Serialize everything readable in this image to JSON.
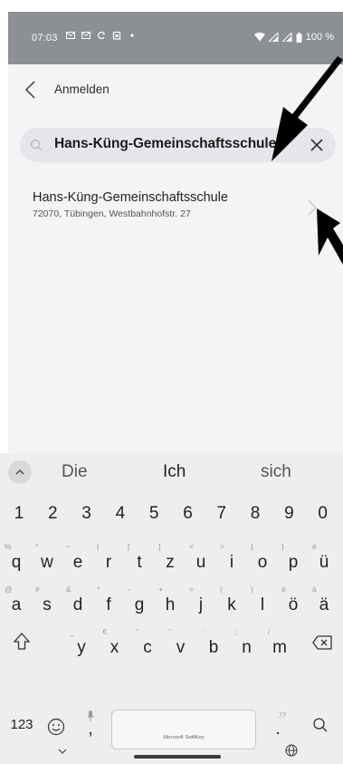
{
  "status_bar": {
    "time": "07:03",
    "left_icons": [
      "mail-icon",
      "mail-icon",
      "sync-icon",
      "calendar-icon",
      "dot-icon"
    ],
    "battery_text": "100 %"
  },
  "header": {
    "back_label": "Anmelden"
  },
  "search": {
    "value": "Hans-Küng-Gemeinschaftsschule"
  },
  "results": [
    {
      "title": "Hans-Küng-Gemeinschaftsschule",
      "subtitle": "72070, Tübingen, Westbahnhofstr. 27"
    }
  ],
  "keyboard": {
    "suggestions": [
      "Die",
      "Ich",
      "sich"
    ],
    "number_row": [
      "1",
      "2",
      "3",
      "4",
      "5",
      "6",
      "7",
      "8",
      "9",
      "0"
    ],
    "row1": [
      {
        "k": "q",
        "a": "%"
      },
      {
        "k": "w",
        "a": "^"
      },
      {
        "k": "e",
        "a": "~"
      },
      {
        "k": "r",
        "a": "|"
      },
      {
        "k": "t",
        "a": "["
      },
      {
        "k": "z",
        "a": "]"
      },
      {
        "k": "u",
        "a": "<"
      },
      {
        "k": "i",
        "a": ">"
      },
      {
        "k": "o",
        "a": "{"
      },
      {
        "k": "p",
        "a": "}"
      },
      {
        "k": "ü",
        "a": "è"
      }
    ],
    "row2": [
      {
        "k": "a",
        "a": "@"
      },
      {
        "k": "s",
        "a": "#"
      },
      {
        "k": "d",
        "a": "&"
      },
      {
        "k": "f",
        "a": "*"
      },
      {
        "k": "g",
        "a": "-"
      },
      {
        "k": "h",
        "a": "+"
      },
      {
        "k": "j",
        "a": "="
      },
      {
        "k": "k",
        "a": "("
      },
      {
        "k": "l",
        "a": ")"
      },
      {
        "k": "ö",
        "a": "é"
      },
      {
        "k": "ä",
        "a": "à"
      }
    ],
    "row3": [
      {
        "k": "y",
        "a": "_"
      },
      {
        "k": "x",
        "a": "€"
      },
      {
        "k": "c",
        "a": "\""
      },
      {
        "k": "v",
        "a": "'"
      },
      {
        "k": "b",
        "a": ":"
      },
      {
        "k": "n",
        "a": ";"
      },
      {
        "k": "m",
        "a": "/"
      }
    ],
    "numbers_key": "123",
    "comma_key": ",",
    "period_key": ".",
    "period_alt": ",!?",
    "spacebar_label": "Microsoft SwiftKey"
  },
  "colors": {
    "status_bar_bg": "#8c8f93",
    "search_bg": "#e5e6ea",
    "caret": "#f05a28",
    "arrow": "#000000"
  }
}
